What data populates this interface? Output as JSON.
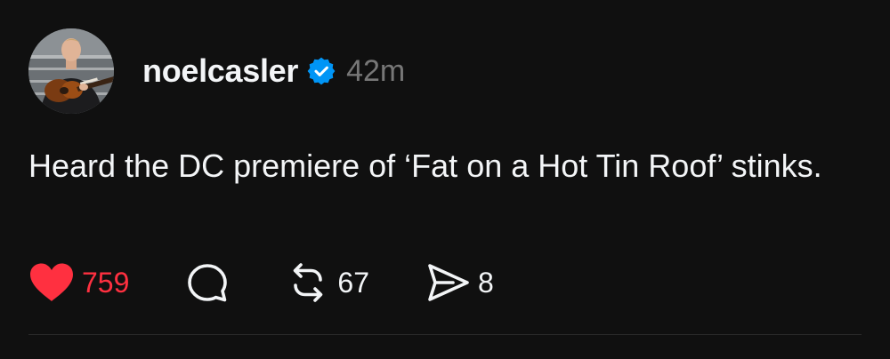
{
  "post": {
    "username": "noelcasler",
    "verified": true,
    "timestamp": "42m",
    "text": "Heard the DC premiere of ‘Fat on a Hot Tin Roof’ stinks.",
    "avatar_icon": "avatar-photo-guitar"
  },
  "actions": {
    "like": {
      "icon": "heart-icon",
      "count": "759",
      "liked": true,
      "color": "#ff3040"
    },
    "reply": {
      "icon": "speech-bubble-icon"
    },
    "repost": {
      "icon": "repost-icon",
      "count": "67"
    },
    "share": {
      "icon": "send-icon",
      "count": "8"
    }
  },
  "colors": {
    "background": "#101010",
    "text": "#f3f5f7",
    "muted": "#777777",
    "verified": "#0095f6",
    "like": "#ff3040"
  }
}
